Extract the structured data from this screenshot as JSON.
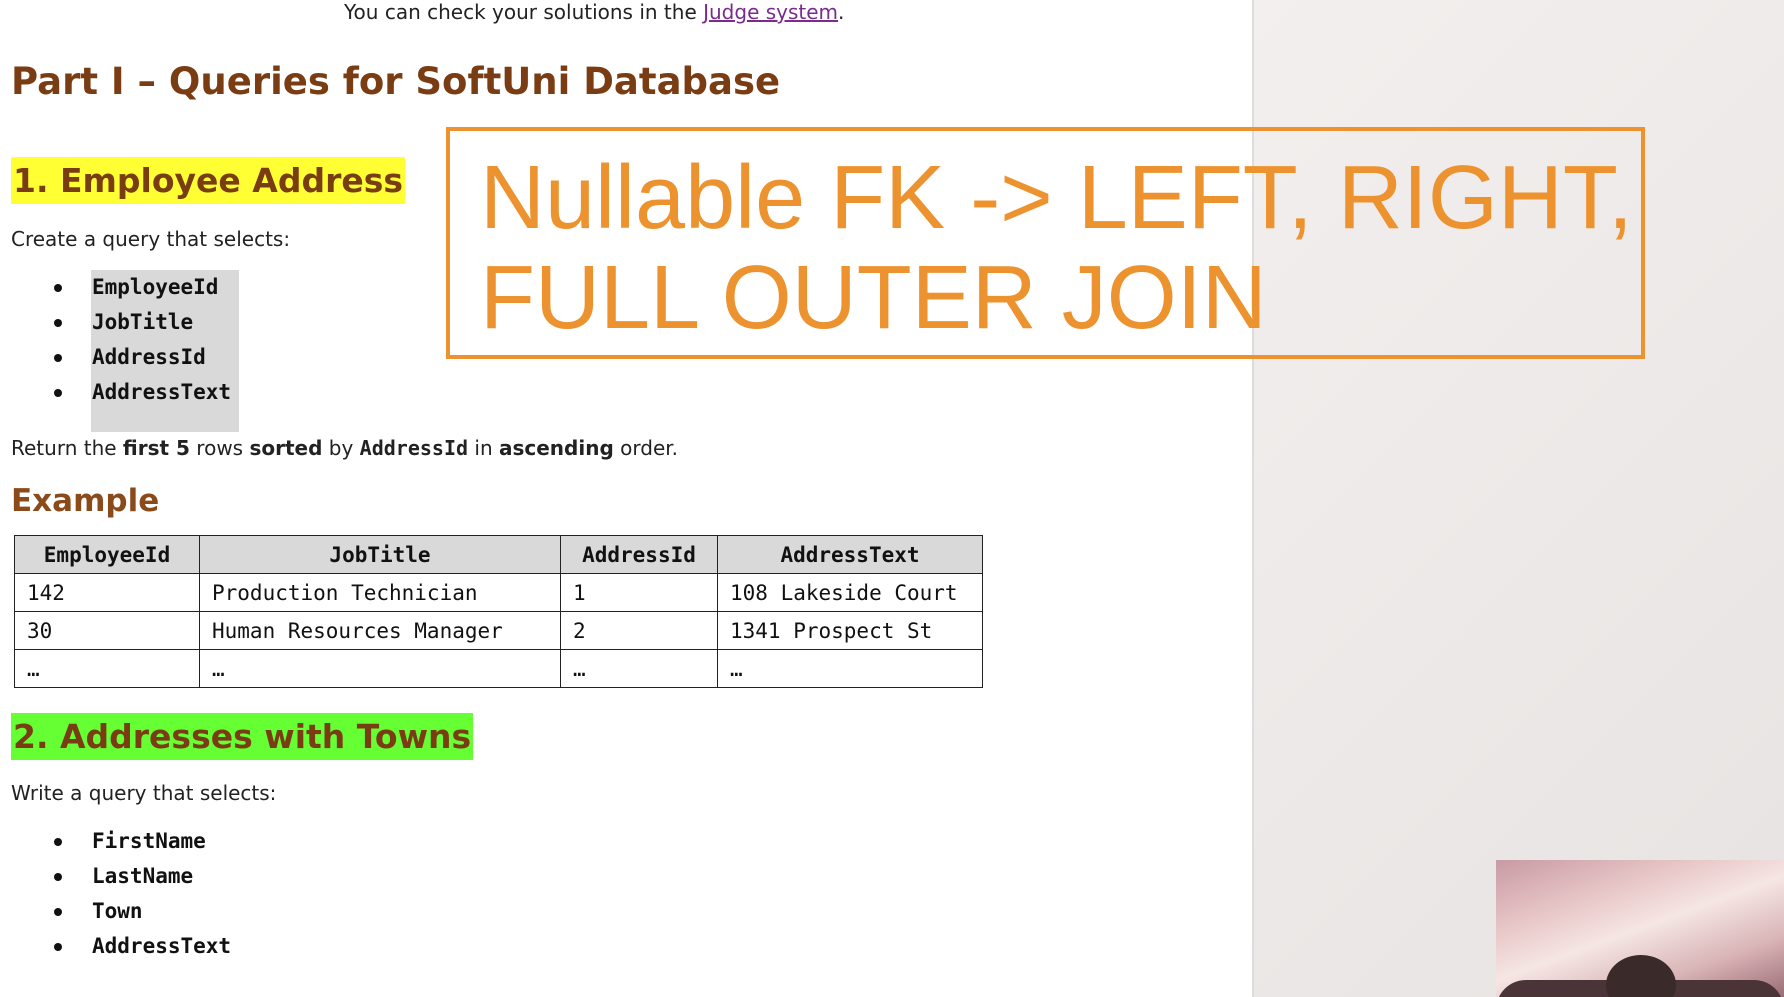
{
  "intro": {
    "prefix": "You can check your solutions in the ",
    "link": "Judge system",
    "suffix": "."
  },
  "part_title": "Part I – Queries for SoftUni Database",
  "section1": {
    "title": "1. Employee Address",
    "lead": "Create a query that selects:",
    "fields": [
      "EmployeeId",
      "JobTitle",
      "AddressId",
      "AddressText"
    ],
    "return_parts": {
      "t1": "Return the ",
      "b1": "first 5",
      "t2": " rows ",
      "b2": "sorted",
      "t3": " by ",
      "code": "AddressId",
      "t4": " in ",
      "b3": "ascending",
      "t5": " order."
    },
    "example_title": "Example",
    "table": {
      "headers": [
        "EmployeeId",
        "JobTitle",
        "AddressId",
        "AddressText"
      ],
      "rows": [
        [
          "142",
          "Production Technician",
          "1",
          "108 Lakeside Court"
        ],
        [
          "30",
          "Human Resources Manager",
          "2",
          "1341 Prospect St"
        ],
        [
          "…",
          "…",
          "…",
          "…"
        ]
      ]
    }
  },
  "section2": {
    "title": "2. Addresses with Towns",
    "lead": "Write a query that selects:",
    "fields": [
      "FirstName",
      "LastName",
      "Town",
      "AddressText"
    ]
  },
  "overlay": {
    "text": "Nullable FK -> LEFT, RIGHT,\nFULL OUTER JOIN",
    "color": "#ec9330"
  },
  "colors": {
    "heading": "#7a3c12",
    "highlight_yellow": "#ffff33",
    "highlight_green": "#66ff33",
    "link": "#7b2b8e"
  }
}
